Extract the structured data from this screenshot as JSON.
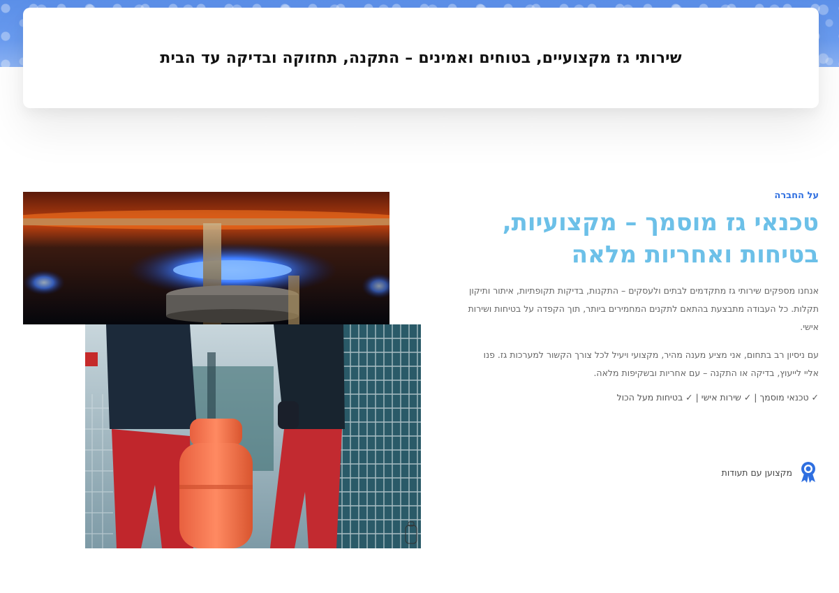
{
  "hero": {
    "title": "שירותי גז מקצועיים, בטוחים ואמינים – התקנה, תחזוקה ובדיקה עד הבית"
  },
  "about": {
    "eyebrow": "על החברה",
    "heading_line1": "טכנאי גז מוסמך – מקצועיות,",
    "heading_line2": "בטיחות ואחריות מלאה",
    "paragraph1": "אנחנו מספקים שירותי גז מתקדמים לבתים ולעסקים – התקנות, בדיקות תקופתיות, איתור ותיקון תקלות. כל העבודה מתבצעת בהתאם לתקנים המחמירים ביותר, תוך הקפדה על בטיחות ושירות אישי.",
    "paragraph2": "עם ניסיון רב בתחום, אני מציע מענה מהיר, מקצועי ויעיל לכל צורך הקשור למערכות גז. פנו אליי לייעוץ, בדיקה או התקנה – עם אחריות ובשקיפות מלאה.",
    "features": "✓ טכנאי מוסמך | ✓ שירות אישי | ✓ בטיחות מעל הכול",
    "badge_label": "מקצוען עם תעודות",
    "badge_icon": "award-ribbon-icon"
  },
  "images": {
    "burner_icon": "gas-burner-flame-photo",
    "cylinder_icon": "gas-cylinder-workers-photo"
  },
  "colors": {
    "accent_blue": "#2f6fe0",
    "heading_light_blue": "#6cc0e8",
    "hero_strip_blue": "#5b8fe8",
    "body_text": "#666666"
  }
}
